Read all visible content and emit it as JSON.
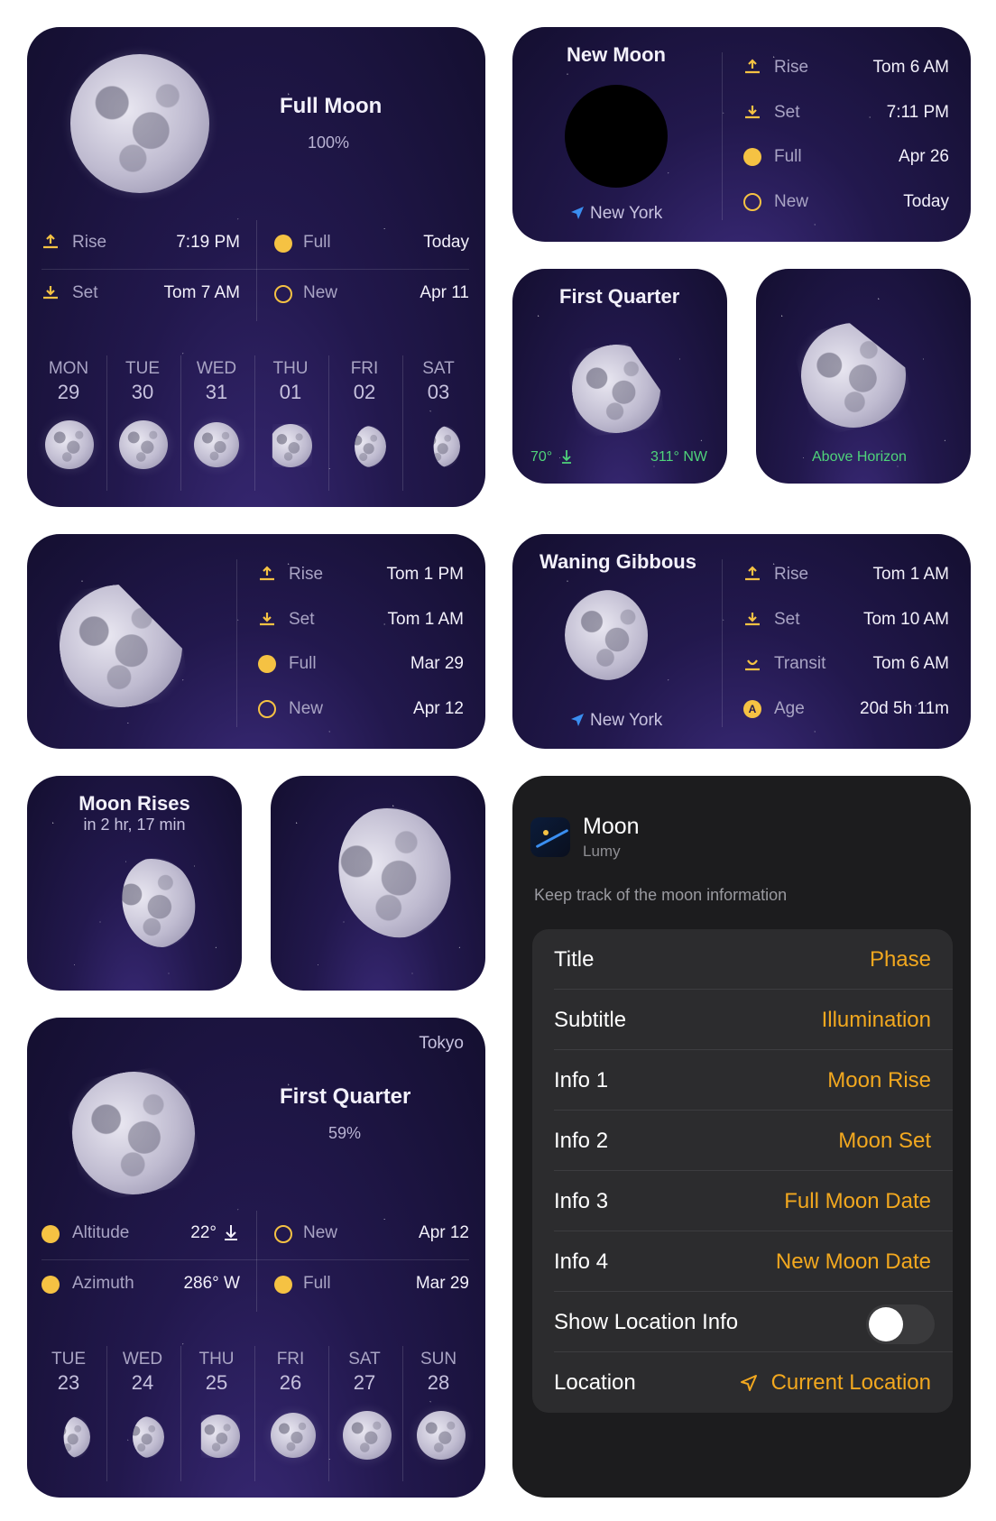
{
  "w1": {
    "title": "Full Moon",
    "illumination": "100%",
    "rise_label": "Rise",
    "rise_value": "7:19 PM",
    "set_label": "Set",
    "set_value": "Tom 7 AM",
    "full_label": "Full",
    "full_value": "Today",
    "new_label": "New",
    "new_value": "Apr 11",
    "days": [
      {
        "name": "MON",
        "date": "29"
      },
      {
        "name": "TUE",
        "date": "30"
      },
      {
        "name": "WED",
        "date": "31"
      },
      {
        "name": "THU",
        "date": "01"
      },
      {
        "name": "FRI",
        "date": "02"
      },
      {
        "name": "SAT",
        "date": "03"
      }
    ]
  },
  "w2": {
    "title": "New Moon",
    "location": "New York",
    "rise_label": "Rise",
    "rise_value": "Tom 6 AM",
    "set_label": "Set",
    "set_value": "7:11 PM",
    "full_label": "Full",
    "full_value": "Apr 26",
    "new_label": "New",
    "new_value": "Today"
  },
  "w3": {
    "title": "First Quarter",
    "altitude": "70°",
    "azimuth": "311° NW"
  },
  "w4": {
    "status": "Above Horizon"
  },
  "w5": {
    "rise_label": "Rise",
    "rise_value": "Tom 1 PM",
    "set_label": "Set",
    "set_value": "Tom 1 AM",
    "full_label": "Full",
    "full_value": "Mar 29",
    "new_label": "New",
    "new_value": "Apr 12"
  },
  "w6": {
    "title": "Waning Gibbous",
    "location": "New York",
    "rise_label": "Rise",
    "rise_value": "Tom 1 AM",
    "set_label": "Set",
    "set_value": "Tom 10 AM",
    "transit_label": "Transit",
    "transit_value": "Tom 6 AM",
    "age_label": "Age",
    "age_value": "20d 5h 11m",
    "age_badge": "A"
  },
  "w7": {
    "title": "Moon Rises",
    "subtitle": "in 2 hr, 17 min"
  },
  "w9": {
    "location": "Tokyo",
    "title": "First Quarter",
    "illumination": "59%",
    "altitude_label": "Altitude",
    "altitude_value": "22°",
    "azimuth_label": "Azimuth",
    "azimuth_value": "286° W",
    "new_label": "New",
    "new_value": "Apr 12",
    "full_label": "Full",
    "full_value": "Mar 29",
    "days": [
      {
        "name": "TUE",
        "date": "23"
      },
      {
        "name": "WED",
        "date": "24"
      },
      {
        "name": "THU",
        "date": "25"
      },
      {
        "name": "FRI",
        "date": "26"
      },
      {
        "name": "SAT",
        "date": "27"
      },
      {
        "name": "SUN",
        "date": "28"
      }
    ]
  },
  "settings": {
    "app_name": "Moon",
    "app_sub": "Lumy",
    "description": "Keep track of the moon information",
    "rows": [
      {
        "key": "Title",
        "value": "Phase"
      },
      {
        "key": "Subtitle",
        "value": "Illumination"
      },
      {
        "key": "Info 1",
        "value": "Moon Rise"
      },
      {
        "key": "Info 2",
        "value": "Moon Set"
      },
      {
        "key": "Info 3",
        "value": "Full Moon Date"
      },
      {
        "key": "Info 4",
        "value": "New Moon Date"
      }
    ],
    "toggle_label": "Show Location Info",
    "toggle_on": false,
    "location_label": "Location",
    "location_value": "Current Location"
  },
  "colors": {
    "accent": "#f2a81f",
    "moon_dot": "#f5c243",
    "green": "#4fd37a",
    "nav_blue": "#3a8ef0"
  }
}
